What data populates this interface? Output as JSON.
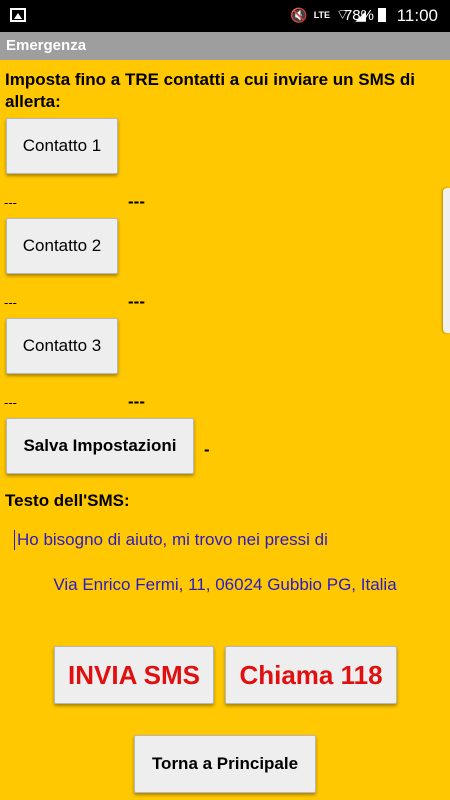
{
  "status_bar": {
    "battery_percent": "78%",
    "time": "11:00",
    "network": "LTE"
  },
  "app": {
    "title": "Emergenza"
  },
  "instructions": "Imposta fino a TRE contatti a cui inviare un SMS di allerta:",
  "contacts": [
    {
      "button_label": "Contatto 1",
      "number": "---",
      "name": "---"
    },
    {
      "button_label": "Contatto 2",
      "number": "---",
      "name": "---"
    },
    {
      "button_label": "Contatto 3",
      "number": "---",
      "name": "---"
    }
  ],
  "save": {
    "label": "Salva Impostazioni",
    "status": "-"
  },
  "sms": {
    "label": "Testo dell'SMS:",
    "text": "Ho bisogno di aiuto, mi trovo nei pressi di",
    "address": "Via Enrico Fermi, 11, 06024 Gubbio PG, Italia"
  },
  "actions": {
    "send_sms": "INVIA SMS",
    "call": "Chiama 118",
    "back": "Torna a Principale"
  },
  "colors": {
    "background": "#ffc800",
    "titlebar": "#9e9e9e",
    "action_text": "#e01010",
    "sms_text": "#2a1bc9"
  }
}
